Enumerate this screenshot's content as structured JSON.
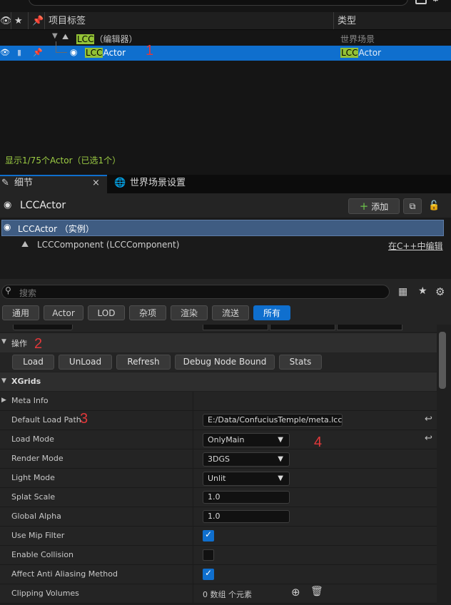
{
  "outliner": {
    "search_query": "lcc",
    "col_label": "项目标签",
    "col_type": "类型",
    "row1": {
      "hl": "LCC",
      "rest": "（编辑器）",
      "type": "世界场景"
    },
    "row2": {
      "hl": "LCC",
      "rest": "Actor",
      "type_hl": "LCC",
      "type_rest": "Actor"
    },
    "status": "显示1/75个Actor（已选1个）"
  },
  "tabs": {
    "details": "细节",
    "world": "世界场景设置",
    "close": "×"
  },
  "details": {
    "actor_name": "LCCActor",
    "add_label": "添加",
    "instance_label": "LCCActor （实例）",
    "component_label": "LCCComponent (LCCComponent)",
    "edit_cpp": "在C++中编辑",
    "search_placeholder": "搜索",
    "filters": [
      "通用",
      "Actor",
      "LOD",
      "杂项",
      "渲染",
      "流送",
      "所有"
    ]
  },
  "props": {
    "ops_category": "操作",
    "buttons": [
      "Load",
      "UnLoad",
      "Refresh",
      "Debug Node Bound",
      "Stats"
    ],
    "xgrids": "XGrids",
    "meta_info": "Meta Info",
    "default_load_path": {
      "label": "Default Load Path",
      "value": "E:/Data/ConfuciusTemple/meta.lcc"
    },
    "load_mode": {
      "label": "Load Mode",
      "value": "OnlyMain"
    },
    "render_mode": {
      "label": "Render Mode",
      "value": "3DGS"
    },
    "light_mode": {
      "label": "Light Mode",
      "value": "Unlit"
    },
    "splat_scale": {
      "label": "Splat Scale",
      "value": "1.0"
    },
    "global_alpha": {
      "label": "Global Alpha",
      "value": "1.0"
    },
    "use_mip": {
      "label": "Use Mip Filter",
      "checked": true
    },
    "enable_collision": {
      "label": "Enable Collision",
      "checked": false
    },
    "affect_aa": {
      "label": "Affect Anti Aliasing Method",
      "checked": true
    },
    "clipping": {
      "label": "Clipping Volumes",
      "value": "0 数组 个元素"
    }
  },
  "annotations": [
    "1",
    "2",
    "3",
    "4"
  ]
}
